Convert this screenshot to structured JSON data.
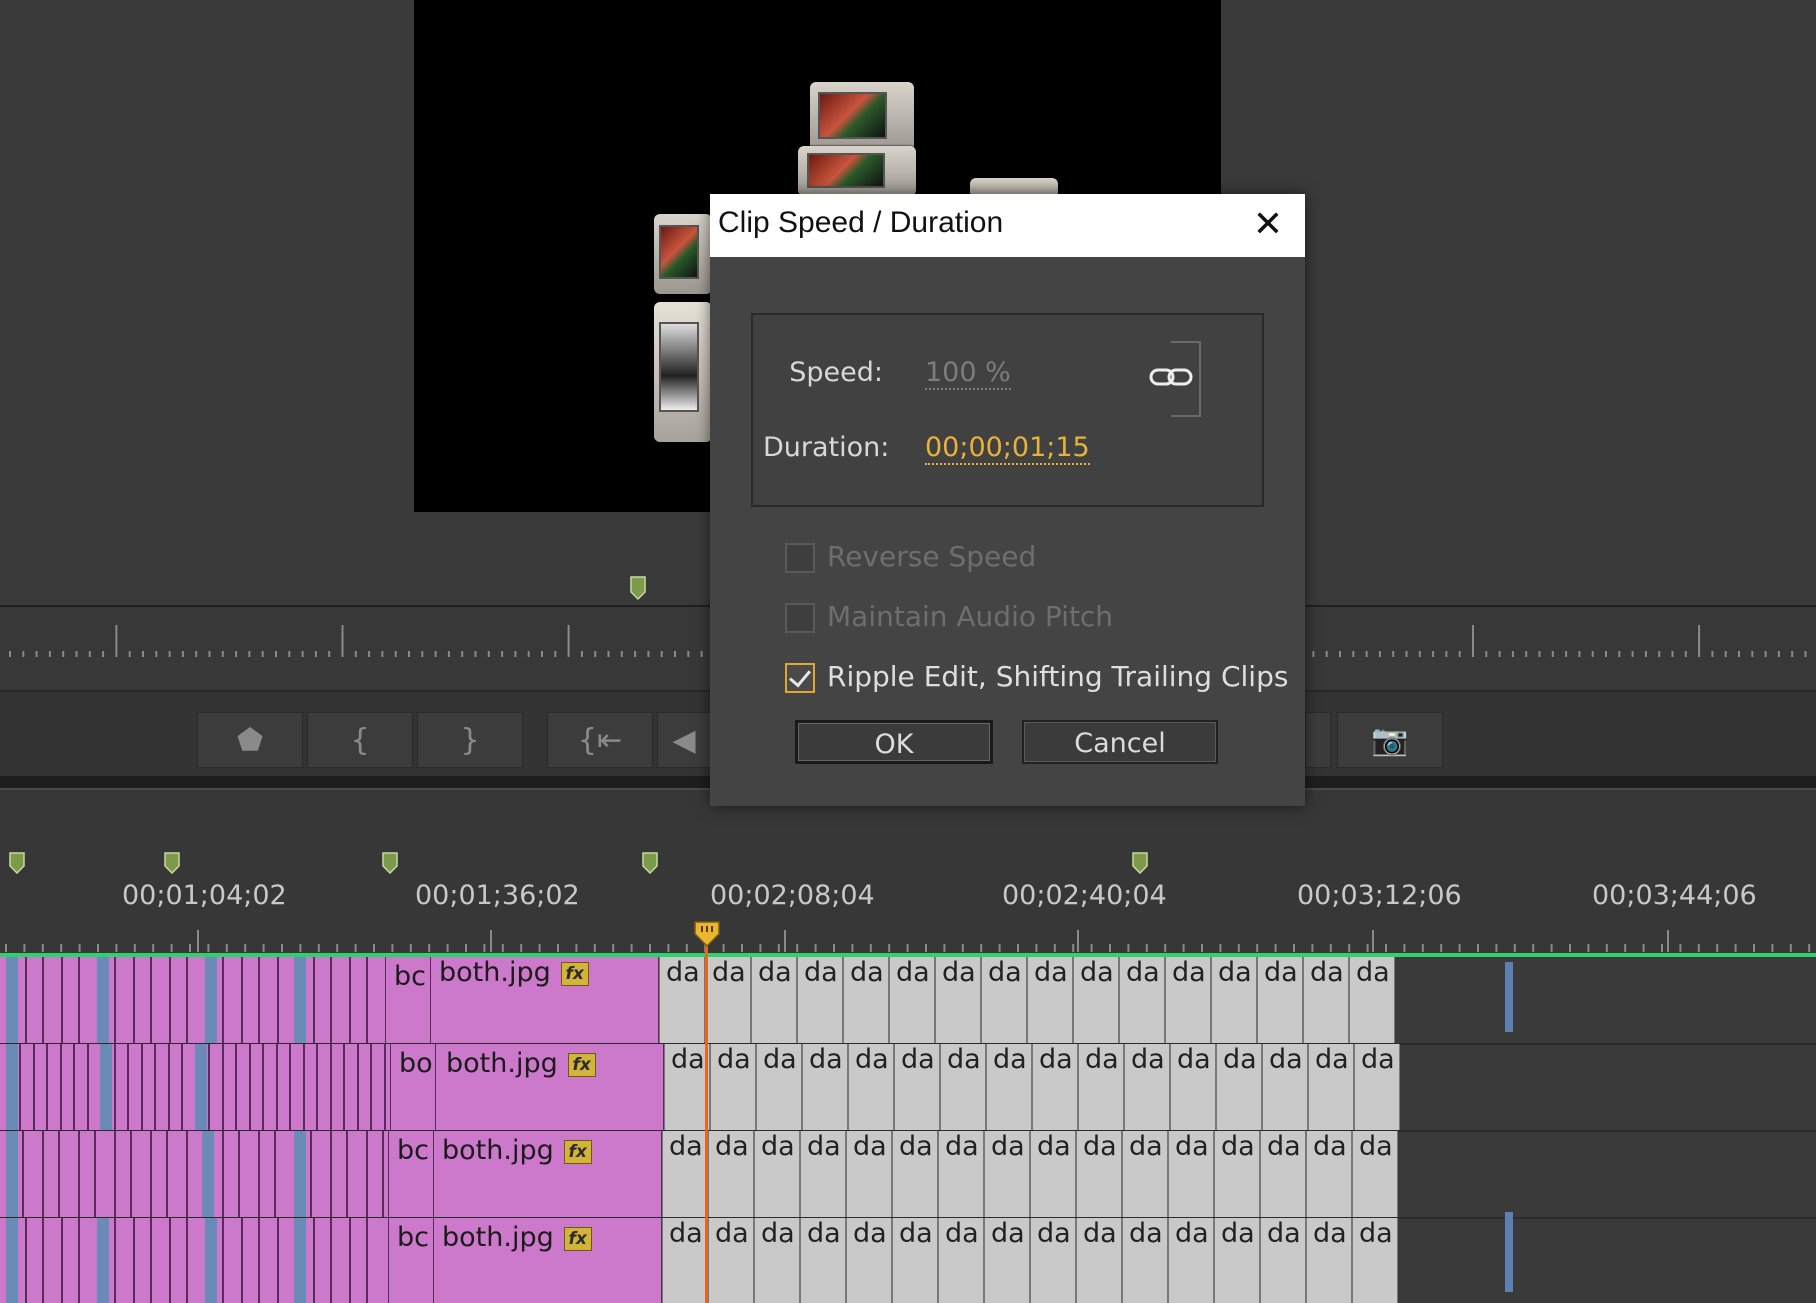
{
  "dialog": {
    "title": "Clip Speed / Duration",
    "close_glyph": "✕",
    "speed_label": "Speed:",
    "speed_value": "100 %",
    "duration_label": "Duration:",
    "duration_value": "00;00;01;15",
    "reverse_speed_label": "Reverse Speed",
    "maintain_audio_pitch_label": "Maintain Audio Pitch",
    "ripple_edit_label": "Ripple Edit, Shifting Trailing Clips",
    "reverse_speed_checked": false,
    "maintain_audio_pitch_checked": false,
    "ripple_edit_checked": true,
    "ok_label": "OK",
    "cancel_label": "Cancel"
  },
  "timeline": {
    "timecodes": [
      "00;01;04;02",
      "00;01;36;02",
      "00;02;08;04",
      "00;02;40;04",
      "00;03;12;06",
      "00;03;44;06"
    ],
    "tracks": [
      {
        "short_label": "bc",
        "clip_name": "both.jpg",
        "fx": "fx",
        "segment_label": "da"
      },
      {
        "short_label": "bo",
        "clip_name": "both.jpg",
        "fx": "fx",
        "segment_label": "da"
      },
      {
        "short_label": "bc",
        "clip_name": "both.jpg",
        "fx": "fx",
        "segment_label": "da"
      },
      {
        "short_label": "bc",
        "clip_name": "both.jpg",
        "fx": "fx",
        "segment_label": "da"
      }
    ]
  },
  "colors": {
    "accent_orange": "#e8b23a",
    "clip_pink": "#cc79cc",
    "timeline_green": "#2fd36b",
    "playhead": "#e8641f"
  }
}
